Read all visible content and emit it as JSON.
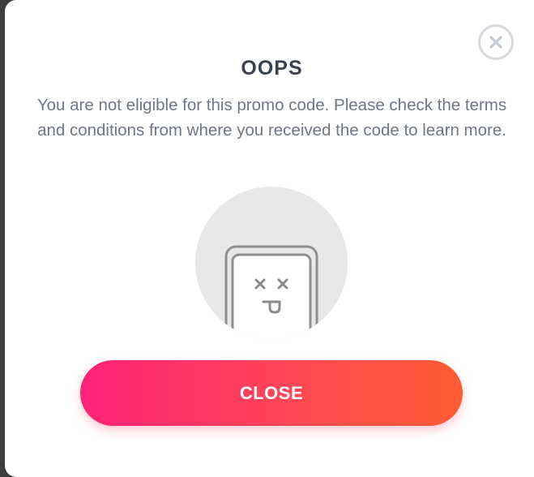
{
  "dialog": {
    "title": "OOPS",
    "message": "You are not eligible for this promo code. Please check the terms and conditions from where you received the code to learn more.",
    "close_label": "CLOSE",
    "dismiss_icon": "close-circle-icon",
    "illustration_icon": "dead-device-face-icon"
  },
  "colors": {
    "accent_start": "#ff2278",
    "accent_end": "#ff5c32",
    "title": "#3a414d",
    "body_text": "#6f7684"
  }
}
